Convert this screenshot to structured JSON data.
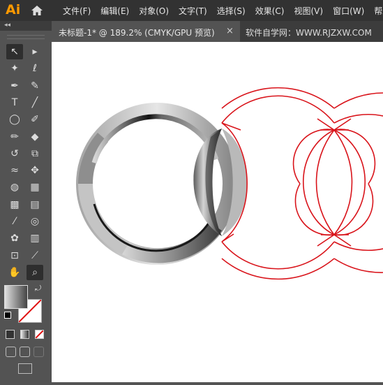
{
  "app": {
    "logo": "Ai"
  },
  "menu": [
    "文件(F)",
    "编辑(E)",
    "对象(O)",
    "文字(T)",
    "选择(S)",
    "效果(C)",
    "视图(V)",
    "窗口(W)",
    "帮助"
  ],
  "tab": {
    "title": "未标题-1* @ 189.2% (CMYK/GPU 预览)",
    "close": "×"
  },
  "watermark": "软件自学网：WWW.RJZXW.COM",
  "panel": {
    "collapse": "◂◂"
  },
  "tools": [
    {
      "name": "selection-tool-icon",
      "glyph": "↖",
      "active": true
    },
    {
      "name": "direct-selection-tool-icon",
      "glyph": "▸"
    },
    {
      "name": "magic-wand-tool-icon",
      "glyph": "✦"
    },
    {
      "name": "lasso-tool-icon",
      "glyph": "ℓ"
    },
    {
      "name": "pen-tool-icon",
      "glyph": "✒"
    },
    {
      "name": "curvature-tool-icon",
      "glyph": "✎"
    },
    {
      "name": "type-tool-icon",
      "glyph": "T"
    },
    {
      "name": "line-tool-icon",
      "glyph": "╱"
    },
    {
      "name": "ellipse-tool-icon",
      "glyph": "◯"
    },
    {
      "name": "paintbrush-tool-icon",
      "glyph": "✐"
    },
    {
      "name": "shaper-tool-icon",
      "glyph": "✏"
    },
    {
      "name": "eraser-tool-icon",
      "glyph": "◆"
    },
    {
      "name": "rotate-tool-icon",
      "glyph": "↺"
    },
    {
      "name": "scale-tool-icon",
      "glyph": "⧉"
    },
    {
      "name": "warp-tool-icon",
      "glyph": "≈"
    },
    {
      "name": "puppet-warp-tool-icon",
      "glyph": "✥"
    },
    {
      "name": "shape-builder-tool-icon",
      "glyph": "◍"
    },
    {
      "name": "perspective-grid-tool-icon",
      "glyph": "▦"
    },
    {
      "name": "mesh-tool-icon",
      "glyph": "▩"
    },
    {
      "name": "gradient-tool-icon",
      "glyph": "▤"
    },
    {
      "name": "eyedropper-tool-icon",
      "glyph": "⁄"
    },
    {
      "name": "blend-tool-icon",
      "glyph": "◎"
    },
    {
      "name": "symbol-sprayer-tool-icon",
      "glyph": "✿"
    },
    {
      "name": "column-graph-tool-icon",
      "glyph": "▥"
    },
    {
      "name": "artboard-tool-icon",
      "glyph": "⊡"
    },
    {
      "name": "slice-tool-icon",
      "glyph": "⟋"
    },
    {
      "name": "hand-tool-icon",
      "glyph": "✋"
    },
    {
      "name": "zoom-tool-icon",
      "glyph": "⌕",
      "active": true
    }
  ],
  "colors": {
    "menubar": "#323232",
    "canvas": "#ffffff",
    "outline": "#d9141b"
  }
}
